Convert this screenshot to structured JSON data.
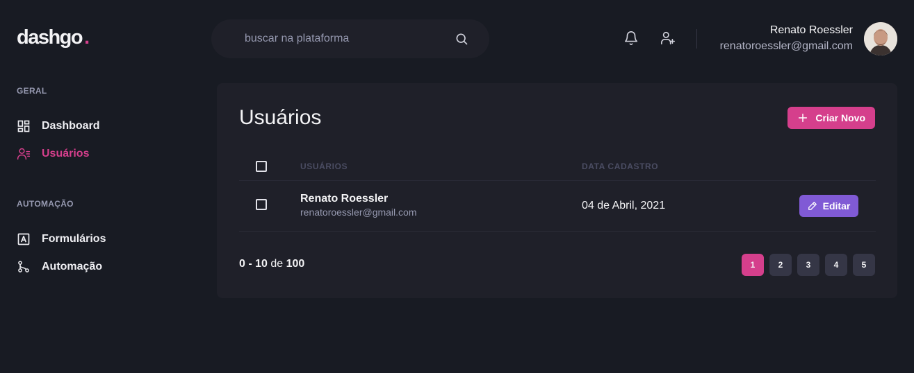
{
  "header": {
    "logo": "dashgo",
    "logo_dot": ".",
    "search_placeholder": "buscar na plataforma",
    "user": {
      "name": "Renato Roessler",
      "email": "renatoroessler@gmail.com"
    }
  },
  "sidebar": {
    "sections": [
      {
        "title": "GERAL",
        "items": [
          {
            "label": "Dashboard",
            "icon": "dashboard-icon",
            "active": false
          },
          {
            "label": "Usuários",
            "icon": "users-icon",
            "active": true
          }
        ]
      },
      {
        "title": "AUTOMAÇÃO",
        "items": [
          {
            "label": "Formulários",
            "icon": "form-icon",
            "active": false
          },
          {
            "label": "Automação",
            "icon": "git-merge-icon",
            "active": false
          }
        ]
      }
    ]
  },
  "main": {
    "title": "Usuários",
    "create_button": "Criar Novo",
    "table": {
      "columns": [
        "USUÁRIOS",
        "DATA CADASTRO"
      ],
      "rows": [
        {
          "name": "Renato Roessler",
          "email": "renatoroessler@gmail.com",
          "date": "04 de Abril, 2021",
          "action": "Editar"
        }
      ]
    },
    "pagination": {
      "range_start": "0",
      "range_sep": " - ",
      "range_end": "10",
      "of_label": " de ",
      "total": "100",
      "pages": [
        "1",
        "2",
        "3",
        "4",
        "5"
      ],
      "current": "1"
    }
  },
  "colors": {
    "background": "#181b23",
    "card": "#1f2029",
    "accent_pink": "#d53f8c",
    "accent_purple": "#805ad5"
  }
}
